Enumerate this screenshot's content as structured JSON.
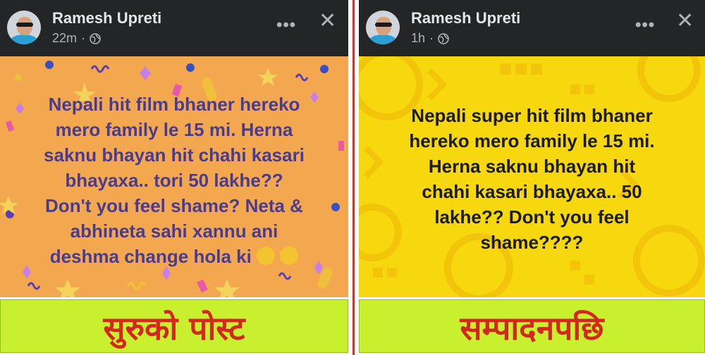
{
  "left": {
    "author": "Ramesh Upreti",
    "time": "22m",
    "more_icon": "more-options-icon",
    "close_icon": "close-icon",
    "post_lines": [
      "Nepali hit film  bhaner hereko",
      "mero family le 15 mi. Herna",
      "saknu bhayan hit chahi kasari",
      "bhayaxa.. tori 50 lakhe??",
      "Don't you feel shame? Neta &",
      "abhineta sahi xannu ani",
      "deshma change hola ki"
    ],
    "caption": "सुरुको पोस्ट",
    "background_color": "#f3a84f",
    "text_color": "#4b3b8f"
  },
  "right": {
    "author": "Ramesh Upreti",
    "time": "1h",
    "more_icon": "more-options-icon",
    "close_icon": "close-icon",
    "post_lines": [
      "Nepali super hit film  bhaner",
      "hereko mero family le 15 mi.",
      "Herna saknu bhayan hit",
      "chahi kasari bhayaxa.. 50",
      "lakhe?? Don't you feel",
      "shame????"
    ],
    "caption": "सम्पादनपछि",
    "background_color": "#f7d80e",
    "text_color": "#1c1c1c"
  },
  "caption_color": "#d2281f",
  "caption_background": "#c9f02e",
  "divider_color": "#d9302a"
}
